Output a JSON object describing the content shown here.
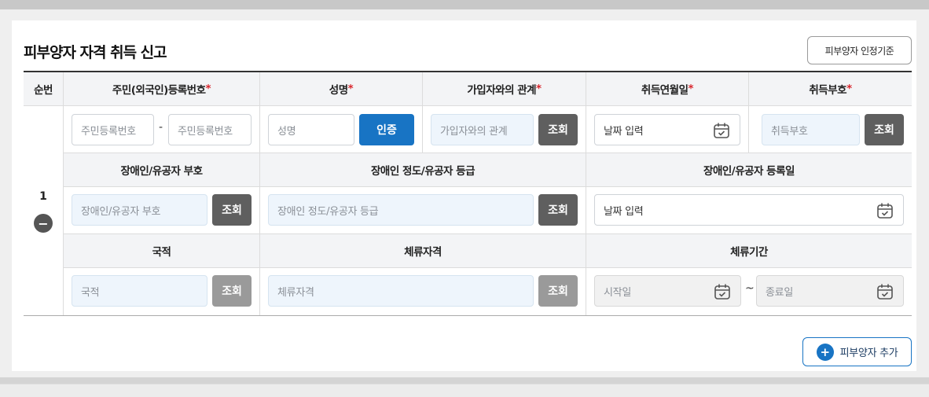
{
  "title": "피부양자 자격 취득 신고",
  "criteria_button": "피부양자 인정기준",
  "headers": {
    "seq": "순번",
    "rrn": "주민(외국인)등록번호",
    "name": "성명",
    "relation": "가입자와의 관계",
    "acq_date": "취득연월일",
    "acq_code": "취득부호",
    "dis_code": "장애인/유공자 부호",
    "dis_grade": "장애인 정도/유공자 등급",
    "dis_reg_date": "장애인/유공자 등록일",
    "nationality": "국적",
    "stay_status": "체류자격",
    "stay_period": "체류기간"
  },
  "required_mark": "*",
  "placeholders": {
    "rrn1": "주민등록번호",
    "rrn2": "주민등록번호",
    "name": "성명",
    "relation": "가입자와의 관계",
    "acq_date": "날짜 입력",
    "acq_code": "취득부호",
    "dis_code": "장애인/유공자 부호",
    "dis_grade": "장애인 정도/유공자 등급",
    "dis_reg_date": "날짜 입력",
    "nationality": "국적",
    "stay_status": "체류자격",
    "stay_start": "시작일",
    "stay_end": "종료일"
  },
  "row": {
    "number": "1",
    "remove_symbol": "−"
  },
  "separators": {
    "rrn_dash": "-",
    "period_tilde": "~"
  },
  "buttons": {
    "verify": "인증",
    "lookup": "조회",
    "add": "피부양자 추가",
    "add_symbol": "+"
  },
  "colors": {
    "primary": "#1874c4",
    "required": "#d9272e",
    "lookup_dark": "#5f5f5f",
    "lookup_disabled": "#9a9a9a"
  }
}
